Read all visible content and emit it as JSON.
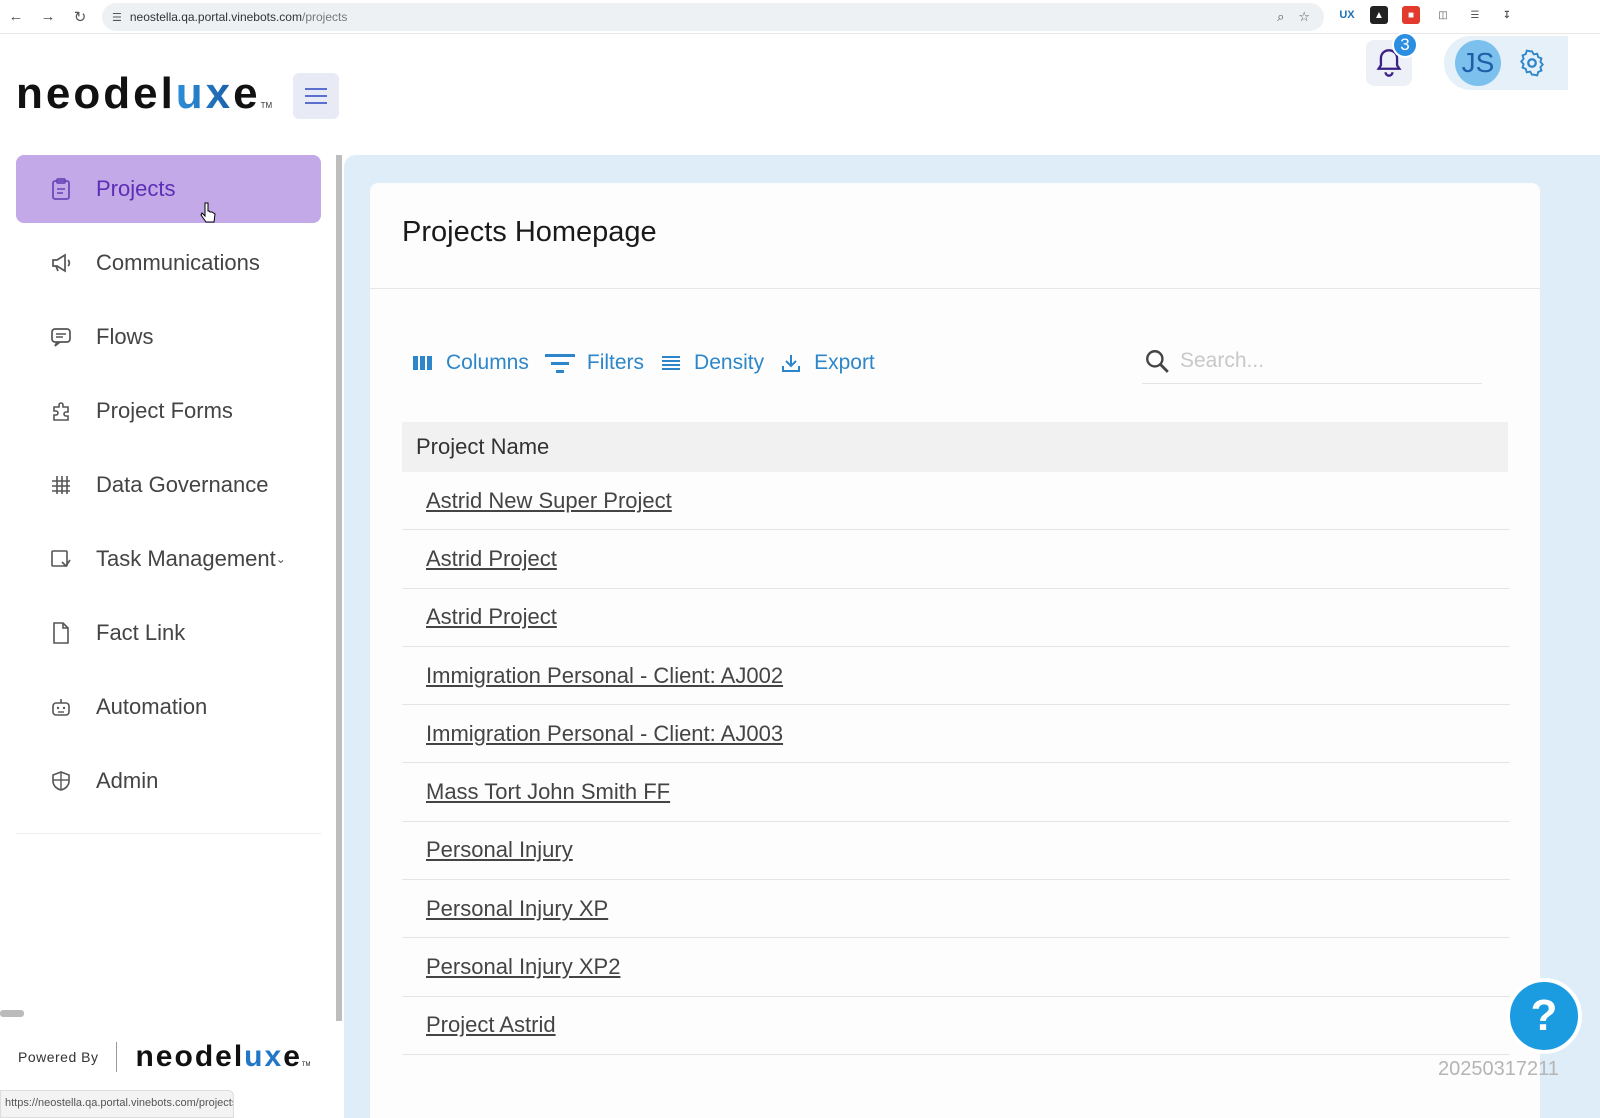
{
  "browser": {
    "url_host": "neostella.qa.portal.vinebots.com",
    "url_path": "/projects",
    "extensions": [
      "ux",
      "ext-dark",
      "ext-red",
      "puzzle"
    ],
    "status_url": "https://neostella.qa.portal.vinebots.com/projects"
  },
  "header": {
    "logo_main": "neodel",
    "logo_accent": "ux",
    "logo_tail": "e",
    "logo_tm": "TM",
    "notification_count": "3",
    "user_initials": "JS"
  },
  "sidebar": {
    "items": [
      {
        "label": "Projects",
        "icon": "clipboard-icon",
        "active": true
      },
      {
        "label": "Communications",
        "icon": "megaphone-icon"
      },
      {
        "label": "Flows",
        "icon": "chat-icon"
      },
      {
        "label": "Project Forms",
        "icon": "puzzle-icon"
      },
      {
        "label": "Data Governance",
        "icon": "grid-icon"
      },
      {
        "label": "Task Management",
        "icon": "task-icon"
      },
      {
        "label": "Fact Link",
        "icon": "document-icon"
      },
      {
        "label": "Automation",
        "icon": "robot-icon"
      },
      {
        "label": "Admin",
        "icon": "shield-icon"
      }
    ],
    "powered_by": "Powered By"
  },
  "main": {
    "title": "Projects Homepage",
    "toolbar": {
      "columns": "Columns",
      "filters": "Filters",
      "density": "Density",
      "export": "Export"
    },
    "search_placeholder": "Search...",
    "column_header": "Project Name",
    "rows": [
      "Astrid New Super Project",
      "Astrid Project",
      "Astrid Project",
      "Immigration Personal - Client: AJ002",
      "Immigration Personal - Client: AJ003",
      "Mass Tort John Smith FF",
      "Personal Injury",
      "Personal Injury XP",
      "Personal Injury XP2",
      "Project Astrid"
    ],
    "stamp": "20250317211"
  },
  "colors": {
    "accent": "#2d86c9",
    "active_nav": "#c3a9e8",
    "main_bg": "#deedf7"
  }
}
